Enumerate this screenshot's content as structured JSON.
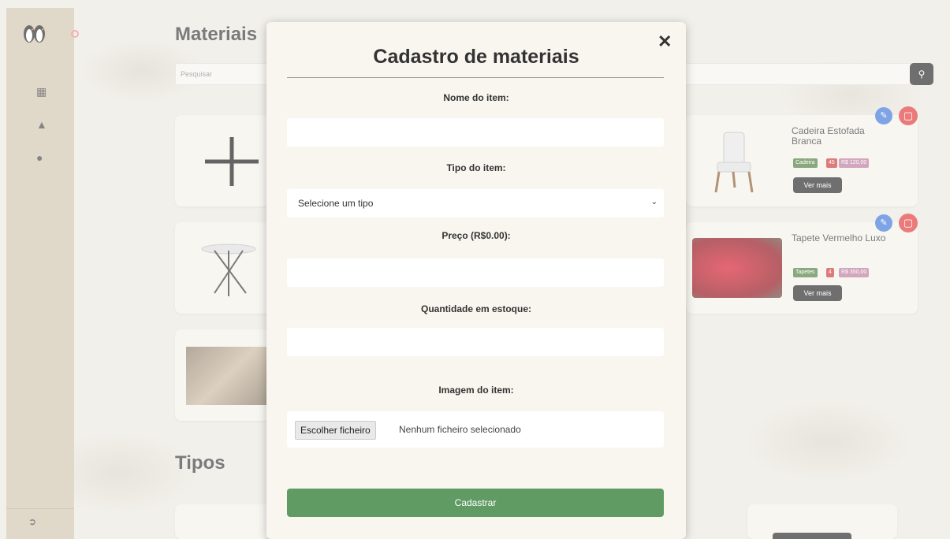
{
  "page": {
    "section_title_materials": "Materiais",
    "section_title_types": "Tipos",
    "search_placeholder": "Pesquisar",
    "icons": {
      "logo": "penguins-logo",
      "nav": [
        "table-icon",
        "store-icon",
        "user-icon"
      ],
      "logout": "logout-icon",
      "search": "search-icon"
    }
  },
  "cards": [
    {
      "title": "Cadeira Estofada Branca",
      "badges": [
        "Cadeira",
        "45",
        "R$ 120,00"
      ],
      "more_label": "Ver mais"
    },
    {
      "title": "Tapete Vermelho Luxo",
      "badges": [
        "Tapetes",
        "4",
        "R$ 350,00"
      ],
      "more_label": "Ver mais"
    }
  ],
  "modal": {
    "title": "Cadastro de materiais",
    "close_label": "✕",
    "name_label": "Nome do item:",
    "type_label": "Tipo do item:",
    "type_selected": "Selecione um tipo",
    "price_label": "Preço (R$0.00):",
    "stock_label": "Quantidade em estoque:",
    "image_label": "Imagem do item:",
    "file_button": "Escolher ficheiro",
    "file_status": "Nenhum ficheiro selecionado",
    "submit_label": "Cadastrar"
  },
  "colors": {
    "sidebar": "#cfc3ab",
    "submit": "#5f9b63",
    "edit": "#3b73d9",
    "delete": "#e03535"
  }
}
